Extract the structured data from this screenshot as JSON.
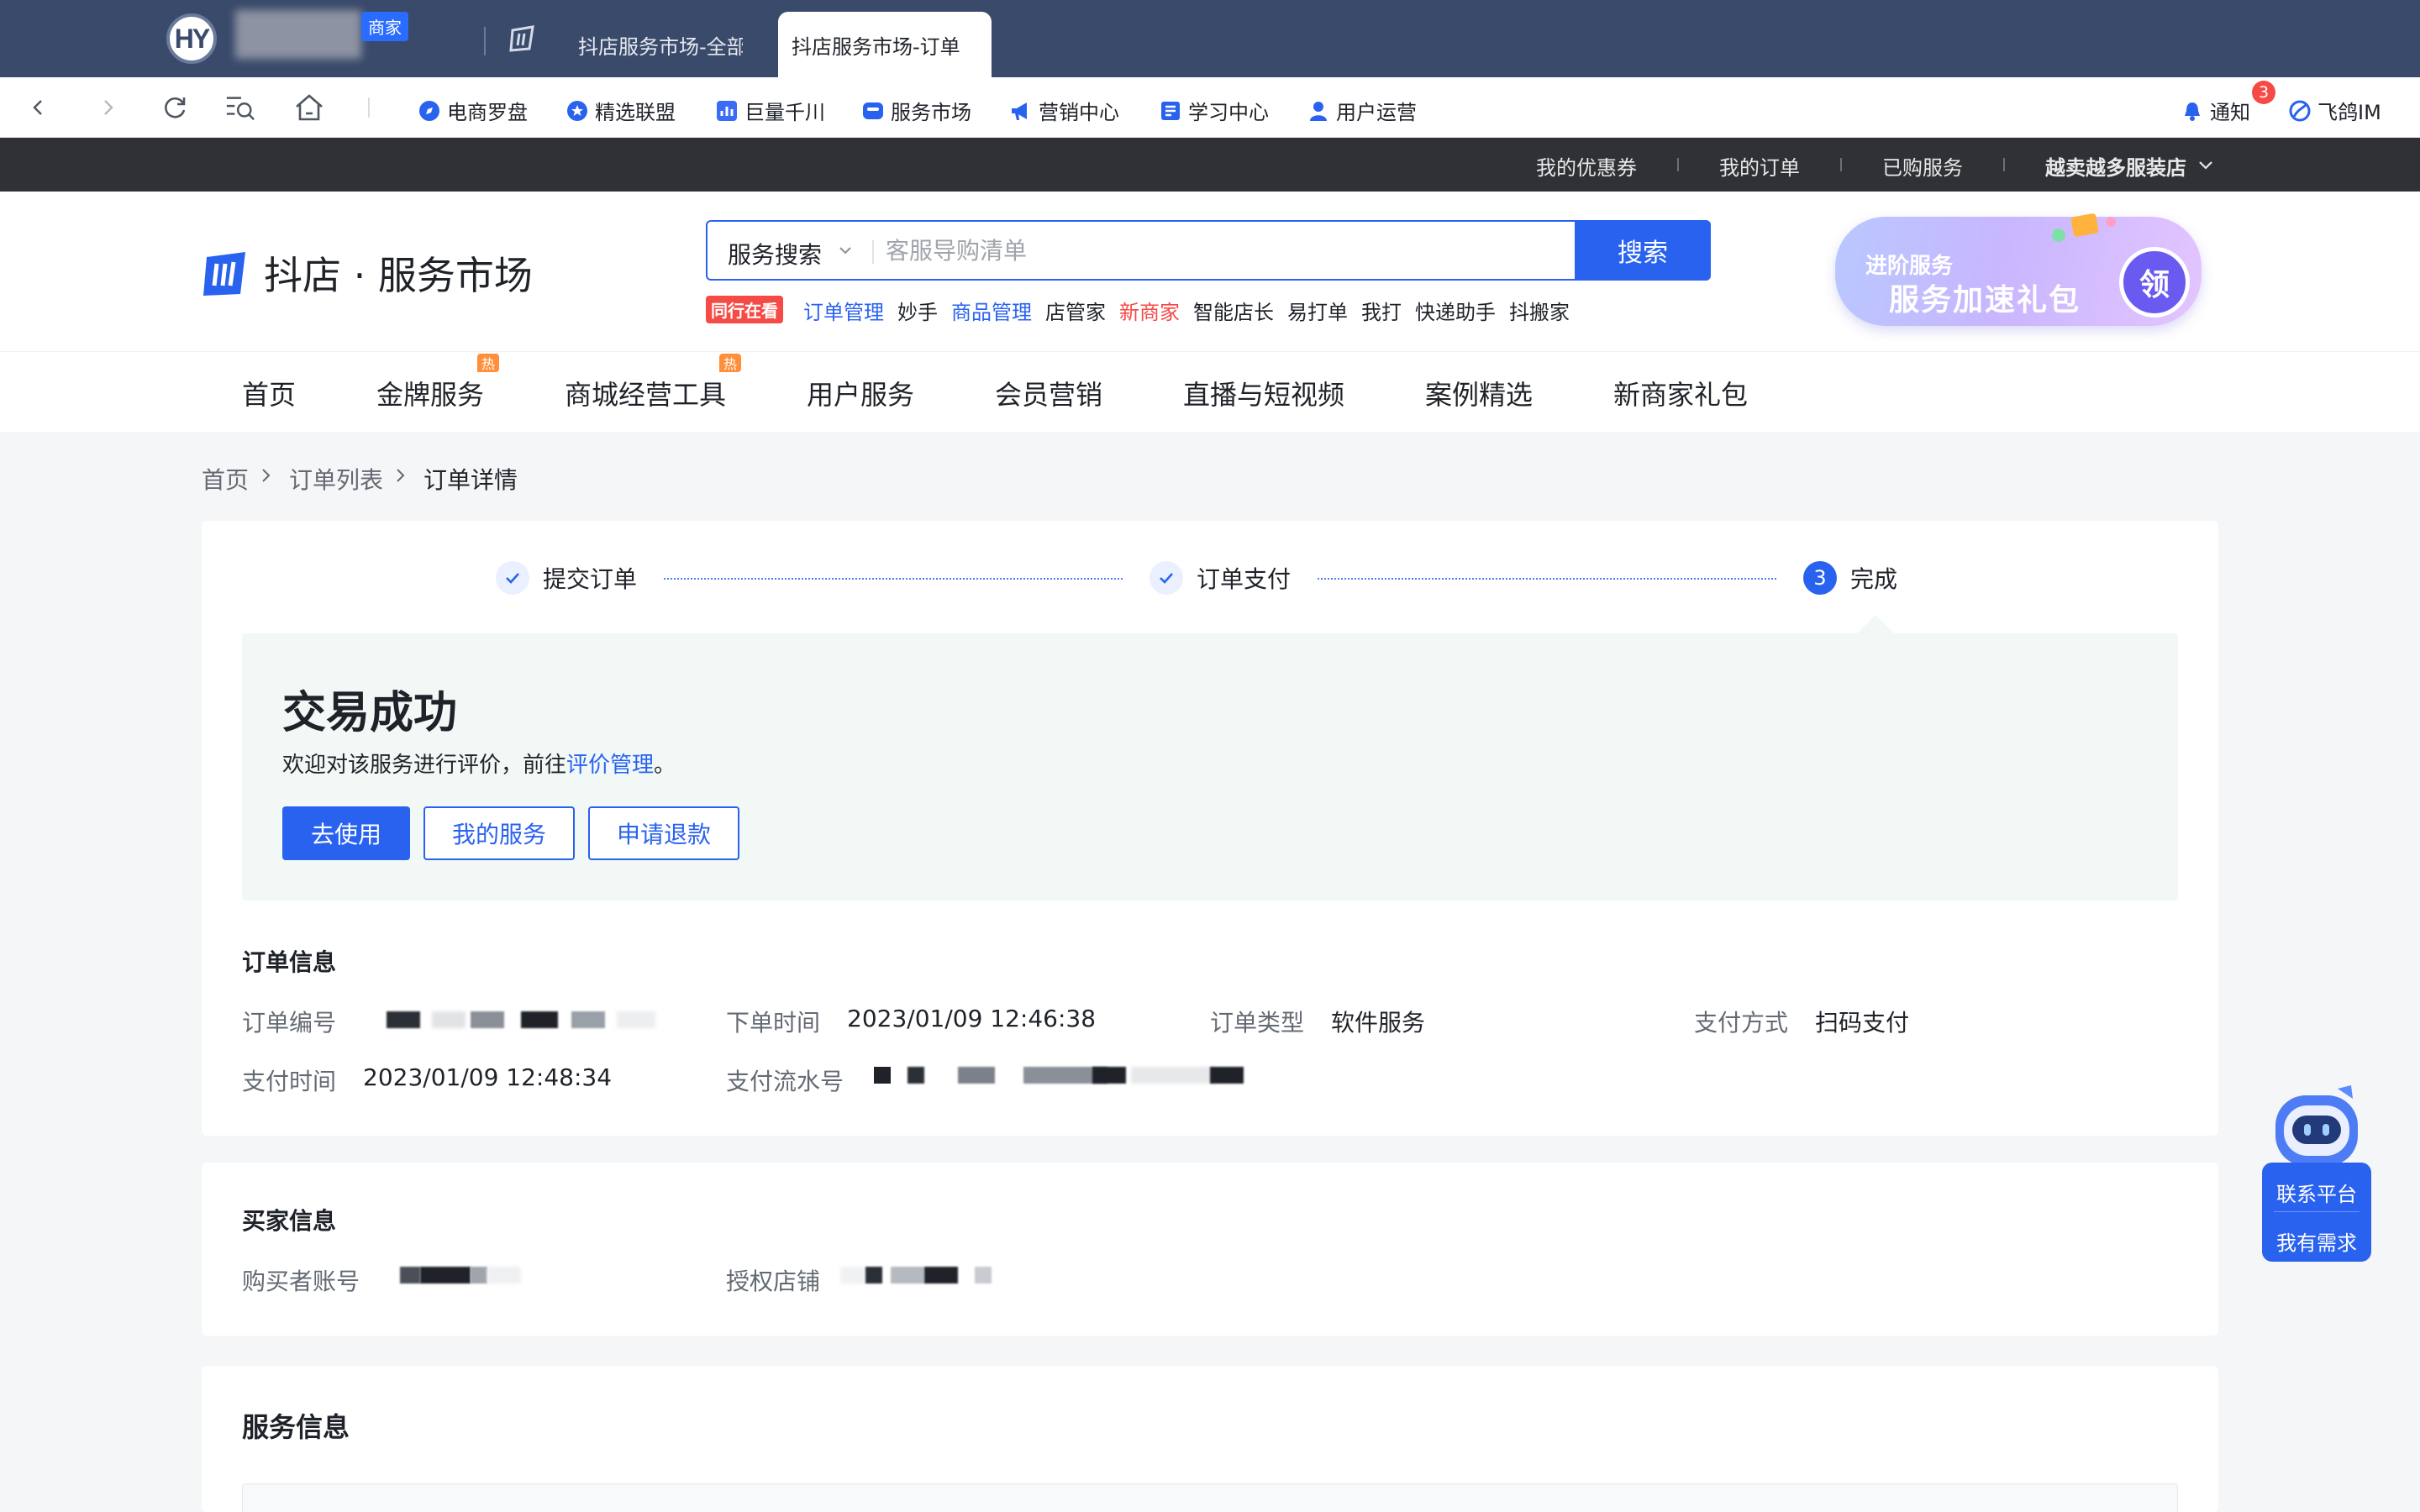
{
  "browser": {
    "account_initials": "HY",
    "account_badge": "商家",
    "tabs": [
      {
        "label": "抖店服务市场-全部",
        "active": false
      },
      {
        "label": "抖店服务市场-订单",
        "active": true
      }
    ],
    "bookmarks": [
      {
        "label": "电商罗盘",
        "icon": "compass-icon",
        "color": "#2a62f0"
      },
      {
        "label": "精选联盟",
        "icon": "star-badge-icon",
        "color": "#2a62f0"
      },
      {
        "label": "巨量千川",
        "icon": "chart-icon",
        "color": "#3b6cf5"
      },
      {
        "label": "服务市场",
        "icon": "store-icon",
        "color": "#2a62f0"
      },
      {
        "label": "营销中心",
        "icon": "megaphone-icon",
        "color": "#2a62f0"
      },
      {
        "label": "学习中心",
        "icon": "book-icon",
        "color": "#2a62f0"
      },
      {
        "label": "用户运营",
        "icon": "user-icon",
        "color": "#2a62f0"
      }
    ],
    "notify_label": "通知",
    "notify_count": "3",
    "im_label": "飞鸽IM"
  },
  "site_bar": {
    "links": [
      "我的优惠券",
      "我的订单",
      "已购服务"
    ],
    "store_name": "越卖越多服装店"
  },
  "header": {
    "logo_text": "抖店 · 服务市场",
    "search": {
      "category": "服务搜索",
      "placeholder": "客服导购清单",
      "button": "搜索"
    },
    "hot_tag": "同行在看",
    "hot_words": [
      {
        "text": "订单管理",
        "color": "#2a62f0"
      },
      {
        "text": "妙手",
        "color": "#1f2329"
      },
      {
        "text": "商品管理",
        "color": "#2a62f0"
      },
      {
        "text": "店管家",
        "color": "#1f2329"
      },
      {
        "text": "新商家",
        "color": "#f54a45"
      },
      {
        "text": "智能店长",
        "color": "#1f2329"
      },
      {
        "text": "易打单",
        "color": "#1f2329"
      },
      {
        "text": "我打",
        "color": "#1f2329"
      },
      {
        "text": "快递助手",
        "color": "#1f2329"
      },
      {
        "text": "抖搬家",
        "color": "#1f2329"
      }
    ],
    "promo": {
      "line1": "进阶服务",
      "line2": "服务加速礼包",
      "claim": "领"
    }
  },
  "main_nav": {
    "items": [
      {
        "label": "首页",
        "hot": false
      },
      {
        "label": "金牌服务",
        "hot": true
      },
      {
        "label": "商城经营工具",
        "hot": true
      },
      {
        "label": "用户服务",
        "hot": false
      },
      {
        "label": "会员营销",
        "hot": false
      },
      {
        "label": "直播与短视频",
        "hot": false
      },
      {
        "label": "案例精选",
        "hot": false
      },
      {
        "label": "新商家礼包",
        "hot": false
      }
    ],
    "hot_badge": "热"
  },
  "breadcrumb": [
    "首页",
    "订单列表",
    "订单详情"
  ],
  "steps": [
    {
      "label": "提交订单",
      "status": "done"
    },
    {
      "label": "订单支付",
      "status": "done"
    },
    {
      "label": "完成",
      "status": "current",
      "number": "3"
    }
  ],
  "result": {
    "title": "交易成功",
    "subtitle_prefix": "欢迎对该服务进行评价，前往",
    "subtitle_link": "评价管理",
    "subtitle_suffix": "。",
    "buttons": {
      "use": "去使用",
      "my_services": "我的服务",
      "refund": "申请退款"
    }
  },
  "order_info": {
    "title": "订单信息",
    "order_no_label": "订单编号",
    "order_time_label": "下单时间",
    "order_time": "2023/01/09 12:46:38",
    "order_type_label": "订单类型",
    "order_type": "软件服务",
    "pay_method_label": "支付方式",
    "pay_method": "扫码支付",
    "pay_time_label": "支付时间",
    "pay_time": "2023/01/09 12:48:34",
    "pay_serial_label": "支付流水号"
  },
  "buyer_info": {
    "title": "买家信息",
    "account_label": "购买者账号",
    "store_label": "授权店铺"
  },
  "service_info": {
    "title": "服务信息"
  },
  "helper": {
    "contact": "联系平台",
    "need": "我有需求"
  },
  "colors": {
    "primary": "#2a62f0",
    "titlebar": "#3a4a6b",
    "sitebar": "#2f3135",
    "success_bg": "#f2f8f6",
    "danger": "#f54a45"
  }
}
